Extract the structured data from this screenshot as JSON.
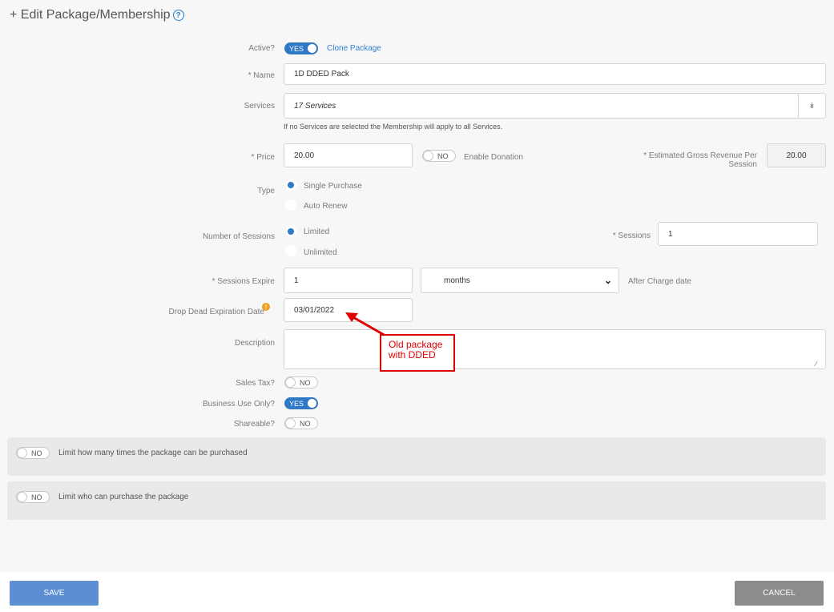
{
  "header": {
    "title": "+ Edit Package/Membership"
  },
  "active": {
    "label": "Active?",
    "toggle": "YES",
    "clone_link": "Clone Package"
  },
  "name": {
    "label": "* Name",
    "value": "1D DDED Pack"
  },
  "services": {
    "label": "Services",
    "value": "17 Services",
    "hint": "If no Services are selected the Membership will apply to all Services."
  },
  "price": {
    "label": "* Price",
    "value": "20.00",
    "donation_toggle": "NO",
    "donation_label": "Enable Donation"
  },
  "gross_revenue": {
    "label_line1": "* Estimated Gross Revenue Per",
    "label_line2": "Session",
    "value": "20.00"
  },
  "type": {
    "label": "Type",
    "options": [
      "Single Purchase",
      "Auto Renew"
    ],
    "selected": "Single Purchase"
  },
  "number_of_sessions": {
    "label": "Number of Sessions",
    "options": [
      "Limited",
      "Unlimited"
    ],
    "selected": "Limited"
  },
  "sessions": {
    "label": "* Sessions",
    "value": "1"
  },
  "sessions_expire": {
    "label": "* Sessions Expire",
    "value": "1",
    "unit": "months",
    "after": "After Charge date"
  },
  "drop_dead": {
    "label": "Drop Dead Expiration Date",
    "value": "03/01/2022"
  },
  "description": {
    "label": "Description",
    "value": ""
  },
  "sales_tax": {
    "label": "Sales Tax?",
    "toggle": "NO"
  },
  "business_use_only": {
    "label": "Business Use Only?",
    "toggle": "YES"
  },
  "shareable": {
    "label": "Shareable?",
    "toggle": "NO"
  },
  "limit_purchases": {
    "toggle": "NO",
    "label": "Limit how many times the package can be purchased"
  },
  "limit_who": {
    "toggle": "NO",
    "label": "Limit who can purchase the package"
  },
  "annotation": {
    "line1": "Old package",
    "line2": "with DDED"
  },
  "footer": {
    "save_label": "SAVE",
    "cancel_label": "CANCEL"
  },
  "colors": {
    "accent": "#2f78c4",
    "cancel": "#8c8c8c",
    "save": "#5b8fd2",
    "annotation": "#e00000",
    "warning": "#f0a01e"
  }
}
